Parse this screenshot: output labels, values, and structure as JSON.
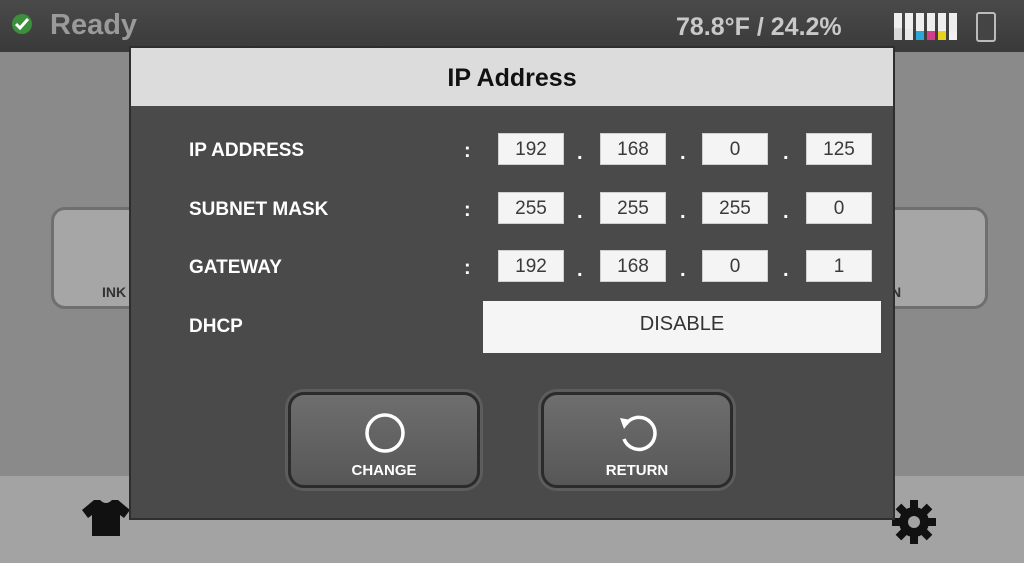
{
  "status": {
    "text": "Ready",
    "environment": "78.8°F / 24.2%"
  },
  "ink_levels": [
    {
      "color": "#d9d9d9",
      "level": 0.45
    },
    {
      "color": "#e8e8e8",
      "level": 0.4
    },
    {
      "color": "#2aa7d6",
      "level": 0.35
    },
    {
      "color": "#d23c8a",
      "level": 0.35
    },
    {
      "color": "#e6d21a",
      "level": 0.35
    },
    {
      "color": "#f2f2f2",
      "level": 0.3
    }
  ],
  "background": {
    "tile_left_label": "INK",
    "tile_right_label": "N"
  },
  "dialog": {
    "title": "IP Address",
    "ip_address": {
      "label": "IP ADDRESS",
      "colon": ":",
      "octets": [
        "192",
        "168",
        "0",
        "125"
      ]
    },
    "subnet_mask": {
      "label": "SUBNET MASK",
      "colon": ":",
      "octets": [
        "255",
        "255",
        "255",
        "0"
      ]
    },
    "gateway": {
      "label": "GATEWAY",
      "colon": ":",
      "octets": [
        "192",
        "168",
        "0",
        "1"
      ]
    },
    "dot": ".",
    "dhcp": {
      "label": "DHCP",
      "value": "DISABLE"
    },
    "change_label": "CHANGE",
    "return_label": "RETURN"
  }
}
